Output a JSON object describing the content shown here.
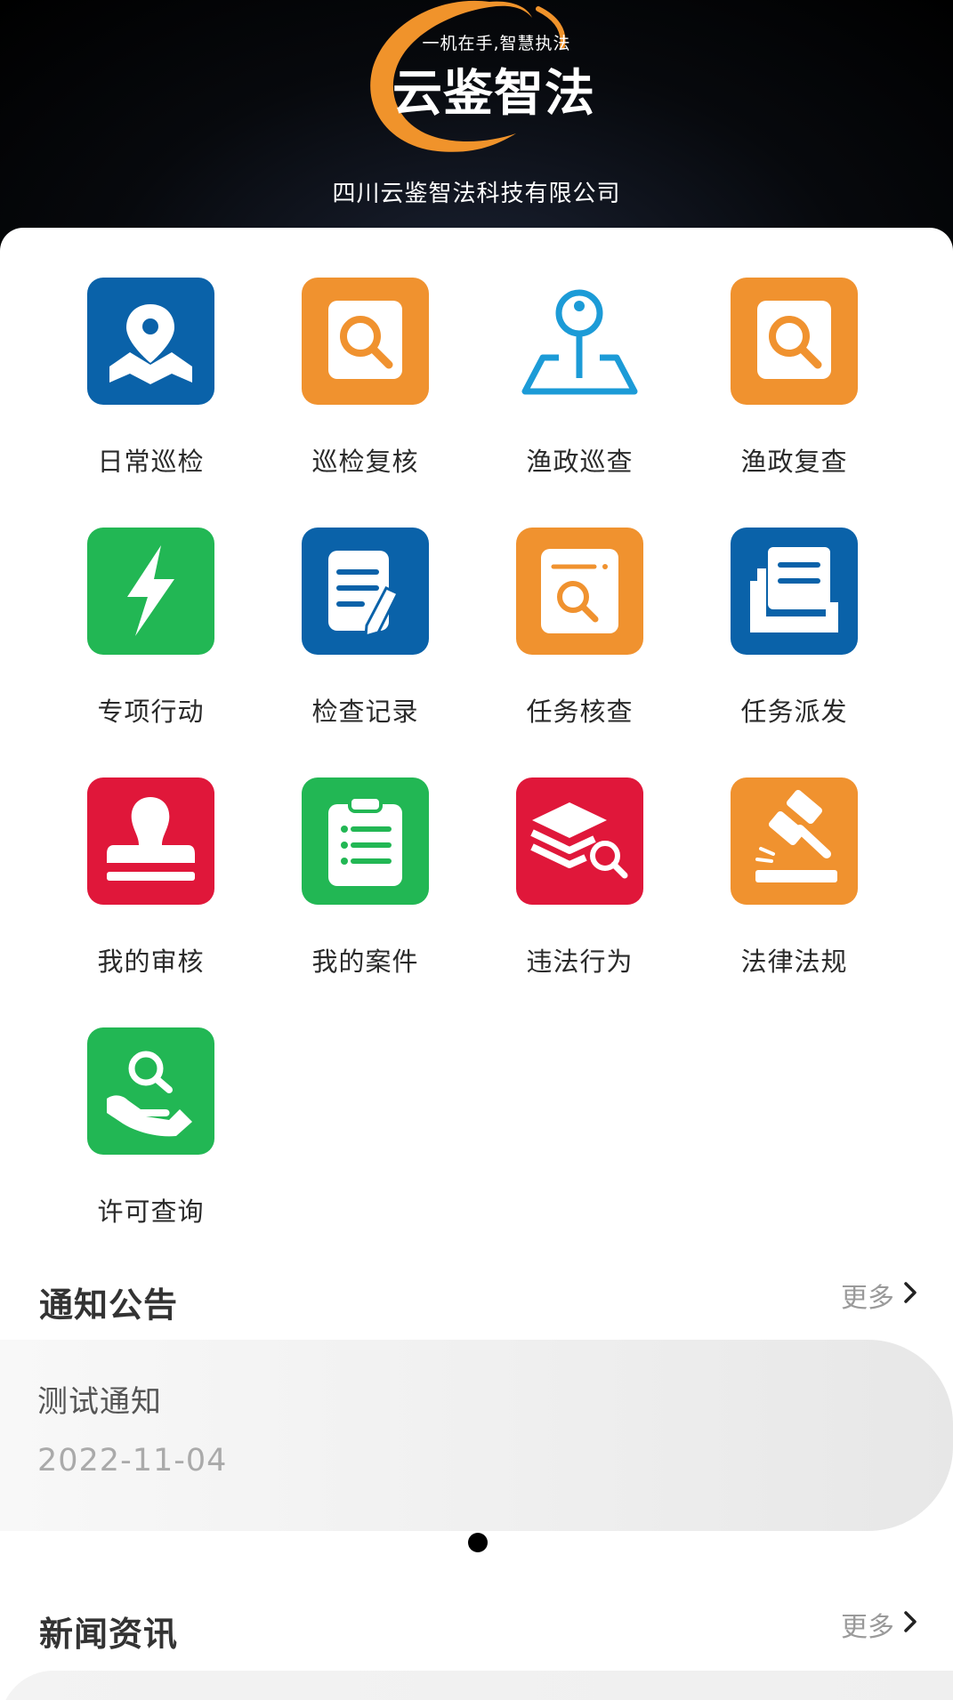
{
  "header": {
    "slogan": "一机在手,智慧执法",
    "app_name": "云鉴智法",
    "company": "四川云鉴智法科技有限公司",
    "accent": "#F0932B"
  },
  "grid": [
    {
      "label": "日常巡检",
      "icon": "map-pin-icon",
      "color": "#0A62A9"
    },
    {
      "label": "巡检复核",
      "icon": "magnifier-icon",
      "color": "#F0922F"
    },
    {
      "label": "渔政巡查",
      "icon": "location-outline-icon",
      "color": "#1C9BD7"
    },
    {
      "label": "渔政复查",
      "icon": "magnifier-icon",
      "color": "#F0922F"
    },
    {
      "label": "专项行动",
      "icon": "lightning-icon",
      "color": "#22B754"
    },
    {
      "label": "检查记录",
      "icon": "document-edit-icon",
      "color": "#0A62A9"
    },
    {
      "label": "任务核查",
      "icon": "document-search-icon",
      "color": "#F0922F"
    },
    {
      "label": "任务派发",
      "icon": "inbox-icon",
      "color": "#0A62A9"
    },
    {
      "label": "我的审核",
      "icon": "stamp-icon",
      "color": "#E0173A"
    },
    {
      "label": "我的案件",
      "icon": "clipboard-list-icon",
      "color": "#22B754"
    },
    {
      "label": "违法行为",
      "icon": "layers-search-icon",
      "color": "#E0173A"
    },
    {
      "label": "法律法规",
      "icon": "gavel-icon",
      "color": "#F0922F"
    },
    {
      "label": "许可查询",
      "icon": "hand-search-icon",
      "color": "#22B754"
    }
  ],
  "notices": {
    "title": "通知公告",
    "more": "更多",
    "item": {
      "title": "测试通知",
      "date": "2022-11-04"
    }
  },
  "news": {
    "title": "新闻资讯",
    "more": "更多"
  }
}
